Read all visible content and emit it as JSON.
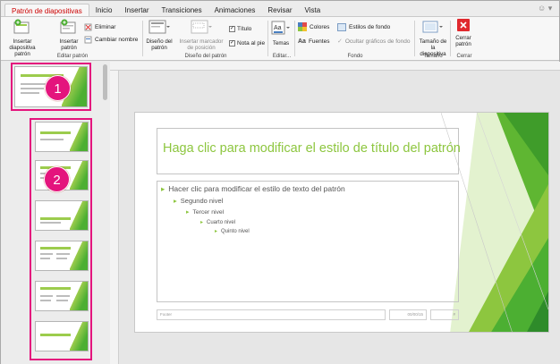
{
  "tabs": [
    "Patrón de diapositivas",
    "Inicio",
    "Insertar",
    "Transiciones",
    "Animaciones",
    "Revisar",
    "Vista"
  ],
  "ribbon": {
    "insert_slide_master": "Insertar diapositiva patrón",
    "insert_layout": "Insertar patrón",
    "delete": "Eliminar",
    "rename": "Cambiar nombre",
    "group_edit_master": "Editar patrón",
    "master_layout": "Diseño del patrón",
    "insert_placeholder": "Insertar marcador de posición",
    "title_check": "Título",
    "footer_check": "Nota al pie",
    "group_master_layout": "Diseño del patrón",
    "themes": "Temas",
    "group_edit_theme": "Editar...",
    "colors": "Colores",
    "fonts": "Fuentes",
    "background_styles": "Estilos de fondo",
    "hide_background": "Ocultar gráficos de fondo",
    "group_background": "Fondo",
    "slide_size": "Tamaño de la diapositiva",
    "group_size": "Tamaño",
    "close_master": "Cerrar patrón",
    "group_close": "Cerrar"
  },
  "callouts": [
    "1",
    "2"
  ],
  "slide": {
    "title": "Haga clic para modificar el estilo de título del patrón",
    "levels": [
      "Hacer clic para modificar el estilo de texto del patrón",
      "Segundo nivel",
      "Tercer nivel",
      "Cuarto nivel",
      "Quinto nivel"
    ],
    "footer_left": "Footer",
    "footer_date": "00/00/15",
    "footer_num": "#"
  },
  "colors": {
    "accent_pink": "#e4147d",
    "active_tab": "#cc0000",
    "theme_green": "#8dc63f"
  }
}
